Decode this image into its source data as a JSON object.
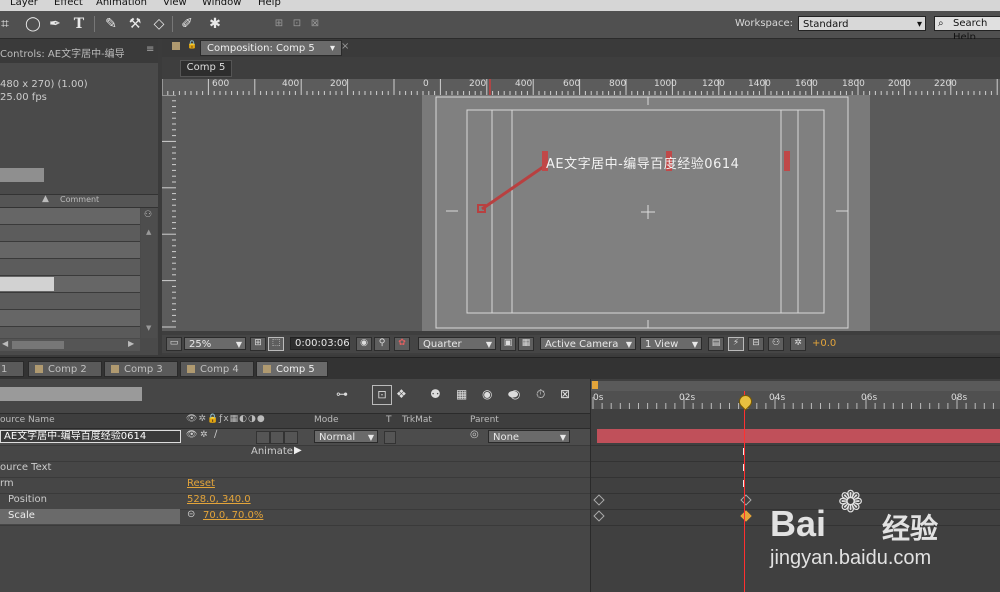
{
  "menu": [
    "Layer",
    "Effect",
    "Animation",
    "View",
    "Window",
    "Help"
  ],
  "workspace": {
    "label": "Workspace:",
    "value": "Standard"
  },
  "search": {
    "placeholder": "Search Help"
  },
  "effect_controls": {
    "tab_label": "Controls: AE文字居中-编导",
    "info_line1": "480 x 270) (1.00)",
    "info_line2": "25.00 fps",
    "column_comment": "Comment"
  },
  "composition": {
    "tab_label": "Composition: Comp 5",
    "breadcrumb": "Comp 5",
    "ruler_labels": [
      "600",
      "400",
      "200",
      "0",
      "200",
      "400",
      "600",
      "800",
      "1000",
      "1200",
      "1400",
      "1600",
      "1800",
      "2000",
      "2200"
    ],
    "text_layer": "AE文字居中-编导百度经验0614",
    "zoom": "25%",
    "timecode": "0:00:03:06",
    "resolution": "Quarter",
    "camera": "Active Camera",
    "views": "1 View",
    "exposure": "+0.0"
  },
  "timeline": {
    "tabs": [
      "1",
      "Comp 2",
      "Comp 3",
      "Comp 4",
      "Comp 5"
    ],
    "active_tab": "Comp 5",
    "col_source": "ource Name",
    "col_mode": "Mode",
    "col_t": "T",
    "col_trkmat": "TrkMat",
    "col_parent": "Parent",
    "layer_name": "AE文字居中-编导百度经验0614",
    "layer_mode": "Normal",
    "layer_parent": "None",
    "animate_label": "Animate:",
    "rows": [
      {
        "label": "ource Text",
        "value": ""
      },
      {
        "label": "rm",
        "value": "Reset"
      },
      {
        "label": "Position",
        "value": "528.0, 340.0"
      },
      {
        "label": "Scale",
        "value": "70.0, 70.0%"
      }
    ],
    "time_labels": [
      "0s",
      "02s",
      "04s",
      "06s",
      "08s"
    ]
  },
  "watermark": {
    "brand": "Bai",
    "brand2": "经验",
    "url": "jingyan.baidu.com"
  },
  "colors": {
    "accent": "#e3a43a",
    "layer_bar": "#c0505a",
    "cti": "#ff3030",
    "motion_path": "#b84040"
  }
}
